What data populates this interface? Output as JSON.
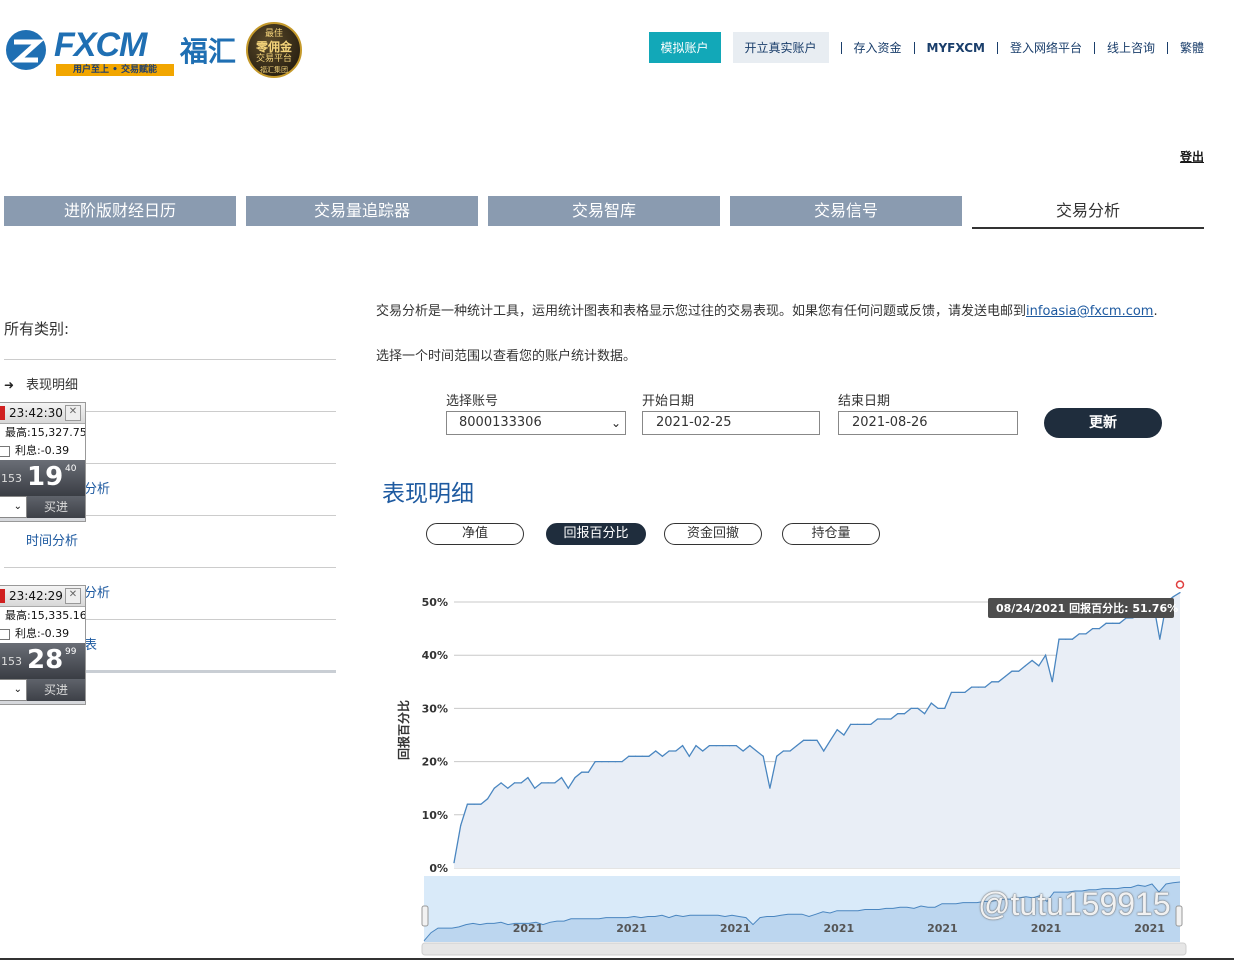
{
  "header": {
    "logo_text": "FXCM",
    "logo_cn": "福汇",
    "logo_tagline": "用户至上 • 交易赋能",
    "badge_lines": [
      "最佳",
      "零佣金",
      "交易平台",
      "福汇集团"
    ],
    "demo_label": "模拟账户",
    "live_label": "开立真实账户",
    "nav_links": [
      "存入资金",
      "MYFXCM",
      "登入网络平台",
      "线上咨询",
      "繁體"
    ],
    "logout": "登出"
  },
  "tabs": [
    "进阶版财经日历",
    "交易量追踪器",
    "交易智库",
    "交易信号",
    "交易分析"
  ],
  "active_tab": "交易分析",
  "sidebar": {
    "title": "所有类别:",
    "items": [
      "表现明细",
      "",
      "分析",
      "时间分析",
      "分析",
      "表"
    ]
  },
  "widgets": [
    {
      "time": "23:42:30",
      "high": "最高:15,327.75",
      "interest": "利息:-0.39",
      "price_left": "153",
      "price_big": "19",
      "price_sup": "40",
      "buy": "买进"
    },
    {
      "time": "23:42:29",
      "high": "最高:15,335.16",
      "interest": "利息:-0.39",
      "price_left": "153",
      "price_big": "28",
      "price_sup": "99",
      "buy": "买进"
    }
  ],
  "intro": {
    "text": "交易分析是一种统计工具，运用统计图表和表格显示您过往的交易表现。如果您有任何问题或反馈，请发送电邮到",
    "email": "infoasia@fxcm.com",
    "tail": ".",
    "text2": "选择一个时间范围以查看您的账户统计数据。"
  },
  "form": {
    "account_label": "选择账号",
    "account_value": "8000133306",
    "start_label": "开始日期",
    "start_value": "2021-02-25",
    "end_label": "结束日期",
    "end_value": "2021-08-26",
    "update": "更新"
  },
  "section_title": "表现明细",
  "pills": [
    "净值",
    "回报百分比",
    "资金回撤",
    "持仓量"
  ],
  "active_pill": "回报百分比",
  "watermark": "@tutu159915",
  "chart_data": {
    "type": "area",
    "ylabel": "回报百分比",
    "y_ticks": [
      "50%",
      "40%",
      "30%",
      "20%",
      "10%",
      "0%"
    ],
    "ylim": [
      0,
      50
    ],
    "navigator_labels": [
      "2021",
      "2021",
      "2021",
      "2021",
      "2021",
      "2021",
      "2021"
    ],
    "tooltip": "08/24/2021 回报百分比: 51.76%",
    "colors": {
      "line": "#4a86c0",
      "fill": "#e9eef6",
      "nav_fill": "#d3e6f8"
    },
    "values": [
      1,
      8,
      12,
      12,
      12,
      13,
      15,
      16,
      15,
      16,
      16,
      17,
      15,
      16,
      16,
      16,
      17,
      15,
      17,
      18,
      18,
      20,
      20,
      20,
      20,
      20,
      21,
      21,
      21,
      21,
      22,
      21,
      22,
      22,
      23,
      21,
      23,
      22,
      23,
      23,
      23,
      23,
      23,
      22,
      23,
      22,
      21,
      15,
      21,
      22,
      22,
      23,
      24,
      24,
      24,
      22,
      24,
      26,
      25,
      27,
      27,
      27,
      27,
      28,
      28,
      28,
      29,
      29,
      30,
      30,
      29,
      31,
      30,
      30,
      33,
      33,
      33,
      34,
      34,
      34,
      35,
      35,
      36,
      37,
      37,
      38,
      39,
      38,
      40,
      35,
      43,
      43,
      43,
      44,
      44,
      45,
      45,
      46,
      46,
      46,
      47,
      47,
      49,
      48,
      50,
      43,
      50,
      51,
      51.76
    ]
  }
}
